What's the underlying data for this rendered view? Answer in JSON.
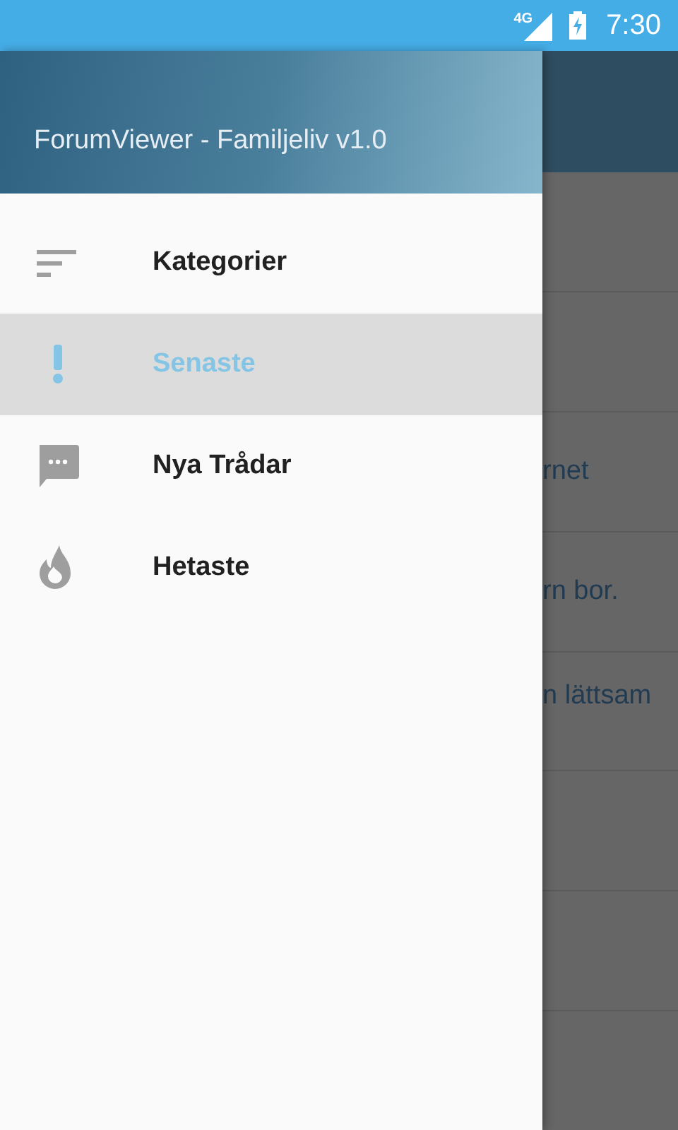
{
  "status_bar": {
    "network": "4G",
    "time": "7:30"
  },
  "drawer": {
    "title": "ForumViewer - Familjeliv v1.0",
    "items": [
      {
        "label": "Kategorier",
        "selected": false
      },
      {
        "label": "Senaste",
        "selected": true
      },
      {
        "label": "Nya Trådar",
        "selected": false
      },
      {
        "label": "Hetaste",
        "selected": false
      }
    ]
  },
  "background_list": {
    "rows": [
      {
        "kind": "blank"
      },
      {
        "kind": "blank"
      },
      {
        "kind": "text",
        "text": "rnet"
      },
      {
        "kind": "text",
        "text": "rn bor."
      },
      {
        "kind": "text",
        "text": "n lättsam"
      },
      {
        "kind": "blank"
      },
      {
        "kind": "blank"
      },
      {
        "kind": "blank"
      }
    ]
  }
}
